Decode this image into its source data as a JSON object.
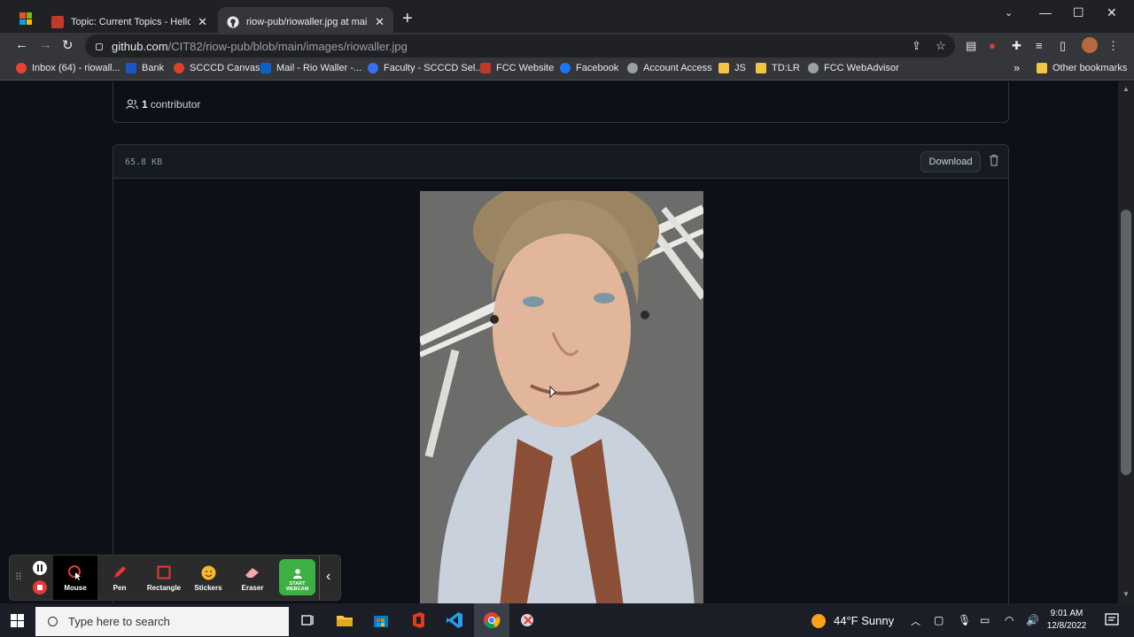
{
  "browser": {
    "tabs": [
      {
        "title": "Topic: Current Topics - Hello Wor",
        "favicon": "discussion-icon",
        "active": false
      },
      {
        "title": "riow-pub/riowaller.jpg at main · ",
        "favicon": "github-icon",
        "active": true
      }
    ],
    "url_host": "github.com",
    "url_path": "/CIT82/riow-pub/blob/main/images/riowaller.jpg",
    "bookmarks": [
      {
        "label": "Inbox (64) - riowall...",
        "icon": "gmail-icon",
        "color": "#ea4335"
      },
      {
        "label": "Bank",
        "icon": "bank-icon",
        "color": "#1a56c4"
      },
      {
        "label": "SCCCD Canvas",
        "icon": "canvas-icon",
        "color": "#e13f2b"
      },
      {
        "label": "Mail - Rio Waller -...",
        "icon": "outlook-icon",
        "color": "#0a64c8"
      },
      {
        "label": "Faculty - SCCCD Sel...",
        "icon": "faculty-icon",
        "color": "#3b6ef0"
      },
      {
        "label": "FCC Website",
        "icon": "fcc-icon",
        "color": "#c0392b"
      },
      {
        "label": "Facebook",
        "icon": "facebook-icon",
        "color": "#1877f2"
      },
      {
        "label": "Account Access",
        "icon": "globe-icon",
        "color": "#9aa0a6"
      },
      {
        "label": "JS",
        "icon": "folder-icon",
        "color": "#f4c542"
      },
      {
        "label": "TD:LR",
        "icon": "folder-icon",
        "color": "#f4c542"
      },
      {
        "label": "FCC WebAdvisor",
        "icon": "globe-icon",
        "color": "#9aa0a6"
      }
    ],
    "more_bookmarks": "»",
    "other_bookmarks": "Other bookmarks"
  },
  "github": {
    "contributors_count": "1",
    "contributors_label": "contributor",
    "file_size": "65.8 KB",
    "download_label": "Download"
  },
  "annotation_toolbar": {
    "tools": [
      "Mouse",
      "Pen",
      "Rectangle",
      "Stickers",
      "Eraser"
    ],
    "active_tool": "Mouse",
    "webcam_line1": "START",
    "webcam_line2": "WEBCAM"
  },
  "taskbar": {
    "search_placeholder": "Type here to search",
    "weather": "44°F  Sunny",
    "time": "9:01 AM",
    "date": "12/8/2022"
  }
}
